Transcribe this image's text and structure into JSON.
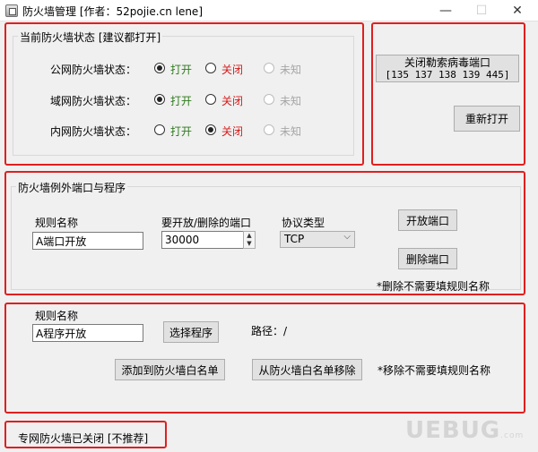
{
  "window": {
    "title": "防火墙管理 [作者：52pojie.cn lene]",
    "min_glyph": "—",
    "max_glyph": "☐",
    "close_glyph": "✕"
  },
  "status_group": {
    "title": "当前防火墙状态 [建议都打开]",
    "rows": [
      {
        "label": "公网防火墙状态：",
        "on": "打开",
        "off": "关闭",
        "unknown": "未知",
        "selected": "on"
      },
      {
        "label": "域网防火墙状态：",
        "on": "打开",
        "off": "关闭",
        "unknown": "未知",
        "selected": "on"
      },
      {
        "label": "内网防火墙状态：",
        "on": "打开",
        "off": "关闭",
        "unknown": "未知",
        "selected": "off"
      }
    ]
  },
  "ransom_group": {
    "close_ports_line1": "关闭勒索病毒端口",
    "close_ports_line2": "[135 137 138 139 445]",
    "reopen": "重新打开"
  },
  "port_group": {
    "title": "防火墙例外端口与程序",
    "rule_name_label": "规则名称",
    "rule_name_value": "A端口开放",
    "port_label": "要开放/删除的端口",
    "port_value": "30000",
    "protocol_label": "协议类型",
    "protocol_value": "TCP",
    "open_port": "开放端口",
    "delete_port": "删除端口",
    "note": "*删除不需要填规则名称"
  },
  "program_group": {
    "rule_name_label": "规则名称",
    "rule_name_value": "A程序开放",
    "choose_program": "选择程序",
    "path_label": "路径：/",
    "add_whitelist": "添加到防火墙白名单",
    "remove_whitelist": "从防火墙白名单移除",
    "note": "*移除不需要填规则名称"
  },
  "status_bar": {
    "text": "专网防火墙已关闭 [不推荐]"
  },
  "watermark": {
    "text": "UEBUG",
    "suffix": ".com"
  },
  "colors": {
    "highlight": "#e01f1f",
    "on": "#2f7a1e",
    "off": "#d21c1c",
    "unknown": "#a6a6a6"
  }
}
